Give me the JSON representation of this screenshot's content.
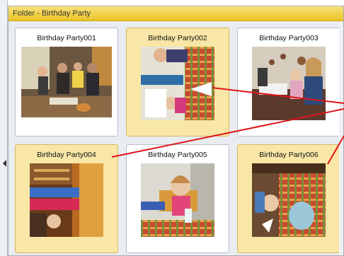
{
  "window": {
    "title": "Folder - Birthday Party"
  },
  "tiles": [
    {
      "label": "Birthday Party001",
      "selected": false
    },
    {
      "label": "Birthday Party002",
      "selected": true
    },
    {
      "label": "Birthday Party003",
      "selected": false
    },
    {
      "label": "Birthday Party004",
      "selected": true
    },
    {
      "label": "Birthday Party005",
      "selected": false
    },
    {
      "label": "Birthday Party006",
      "selected": true
    }
  ],
  "colors": {
    "title_bar": "#e9c225",
    "selected_tile": "#f8e7a6",
    "callout_line": "#e0141b"
  }
}
